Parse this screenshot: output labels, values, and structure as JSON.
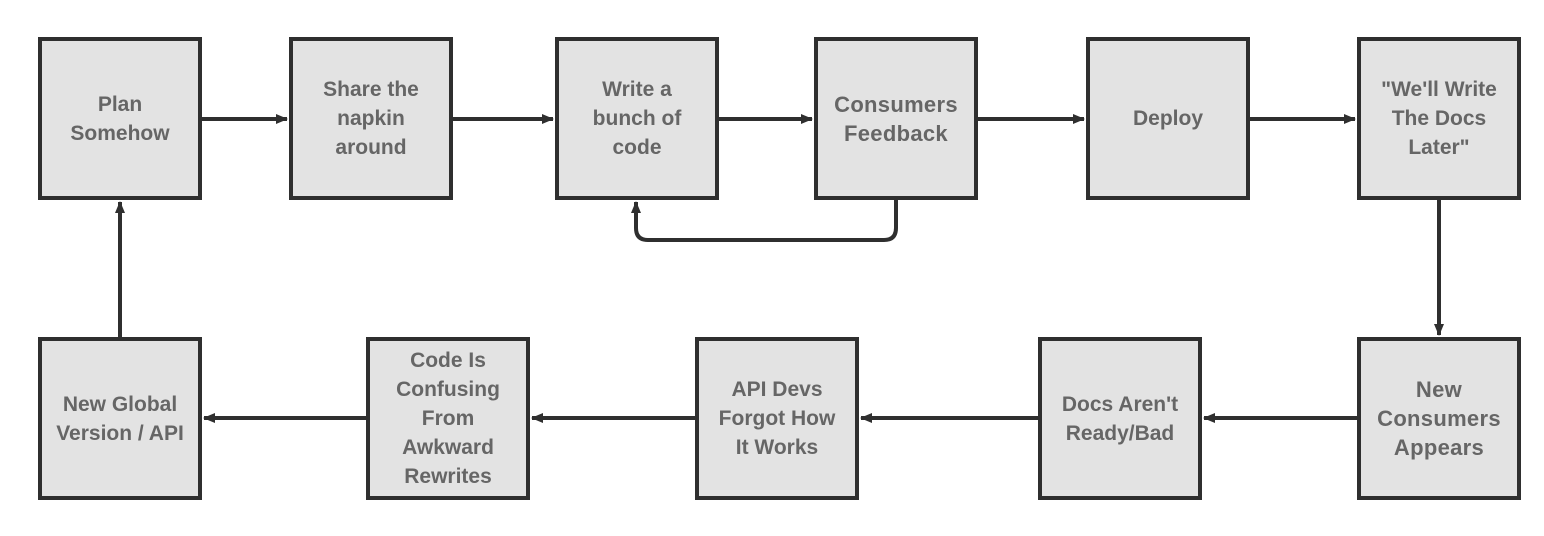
{
  "diagram": {
    "type": "flowchart",
    "colors": {
      "node_fill": "#e3e3e3",
      "node_border": "#2f2f2f",
      "text": "#666666",
      "edge": "#2f2f2f",
      "background": "#ffffff"
    },
    "nodes": [
      {
        "id": "plan",
        "label": "Plan\nSomehow"
      },
      {
        "id": "share",
        "label": "Share the\nnapkin\naround"
      },
      {
        "id": "write",
        "label": "Write a\nbunch of\ncode"
      },
      {
        "id": "feedback",
        "label": "Consumers\nFeedback"
      },
      {
        "id": "deploy",
        "label": "Deploy"
      },
      {
        "id": "docs-later",
        "label": "\"We'll Write\nThe Docs\nLater\""
      },
      {
        "id": "new-consumers",
        "label": "New\nConsumers\nAppears"
      },
      {
        "id": "docs-bad",
        "label": "Docs Aren't\nReady/Bad"
      },
      {
        "id": "devs-forgot",
        "label": "API Devs\nForgot How\nIt Works"
      },
      {
        "id": "code-confusing",
        "label": "Code Is\nConfusing\nFrom\nAwkward\nRewrites"
      },
      {
        "id": "new-global",
        "label": "New Global\nVersion / API"
      }
    ],
    "edges": [
      {
        "from": "plan",
        "to": "share"
      },
      {
        "from": "share",
        "to": "write"
      },
      {
        "from": "write",
        "to": "feedback"
      },
      {
        "from": "feedback",
        "to": "write"
      },
      {
        "from": "feedback",
        "to": "deploy"
      },
      {
        "from": "deploy",
        "to": "docs-later"
      },
      {
        "from": "docs-later",
        "to": "new-consumers"
      },
      {
        "from": "new-consumers",
        "to": "docs-bad"
      },
      {
        "from": "docs-bad",
        "to": "devs-forgot"
      },
      {
        "from": "devs-forgot",
        "to": "code-confusing"
      },
      {
        "from": "code-confusing",
        "to": "new-global"
      },
      {
        "from": "new-global",
        "to": "plan"
      }
    ]
  }
}
